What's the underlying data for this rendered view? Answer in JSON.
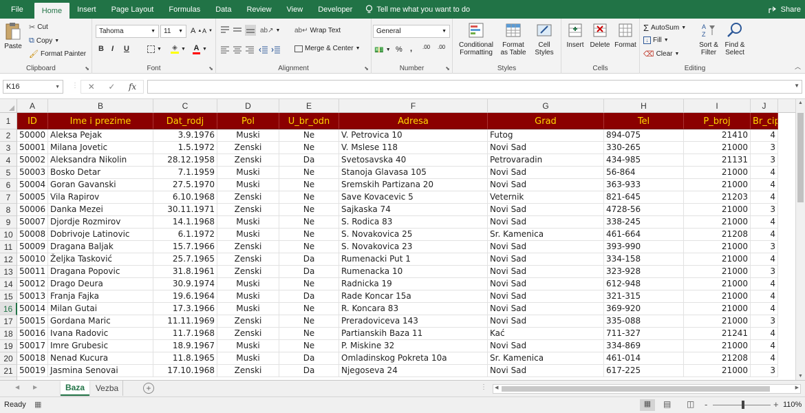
{
  "menu": {
    "tabs": [
      "File",
      "Home",
      "Insert",
      "Page Layout",
      "Formulas",
      "Data",
      "Review",
      "View",
      "Developer"
    ],
    "tell_me": "Tell me what you want to do",
    "share": "Share"
  },
  "ribbon": {
    "clipboard": {
      "label": "Clipboard",
      "paste": "Paste",
      "cut": "Cut",
      "copy": "Copy",
      "format_painter": "Format Painter"
    },
    "font": {
      "label": "Font",
      "name": "Tahoma",
      "size": "11",
      "bold": "B",
      "italic": "I",
      "underline": "U"
    },
    "alignment": {
      "label": "Alignment",
      "wrap_text": "Wrap Text",
      "merge_center": "Merge & Center"
    },
    "number": {
      "label": "Number",
      "format": "General",
      "percent": "%",
      "comma": ",",
      "inc_decimal": ".00",
      "dec_decimal": ".00"
    },
    "styles": {
      "label": "Styles",
      "conditional": "Conditional Formatting",
      "format_as_table": "Format as Table",
      "cell_styles": "Cell Styles"
    },
    "cells": {
      "label": "Cells",
      "insert": "Insert",
      "delete": "Delete",
      "format": "Format"
    },
    "editing": {
      "label": "Editing",
      "autosum": "AutoSum",
      "fill": "Fill",
      "clear": "Clear",
      "sort_filter": "Sort & Filter",
      "find_select": "Find & Select"
    }
  },
  "formula_bar": {
    "name_box": "K16",
    "fx": "fx",
    "content": ""
  },
  "columns": [
    "A",
    "B",
    "C",
    "D",
    "E",
    "F",
    "G",
    "H",
    "I",
    "J"
  ],
  "headers": [
    "ID",
    "Ime i prezime",
    "Dat_rodj",
    "Pol",
    "U_br_odn",
    "Adresa",
    "Grad",
    "Tel",
    "P_broj",
    "Br_cip"
  ],
  "rows": [
    [
      "50000",
      "Aleksa Pejak",
      "3.9.1976",
      "Muski",
      "Ne",
      "V. Petrovica 10",
      "Futog",
      "894-075",
      "21410",
      "4"
    ],
    [
      "50001",
      "Milana Jovetic",
      "1.5.1972",
      "Zenski",
      "Ne",
      "V. Mslese 118",
      "Novi Sad",
      "330-265",
      "21000",
      "3"
    ],
    [
      "50002",
      "Aleksandra Nikolin",
      "28.12.1958",
      "Zenski",
      "Da",
      "Svetosavska 40",
      "Petrovaradin",
      "434-985",
      "21131",
      "3"
    ],
    [
      "50003",
      "Bosko Detar",
      "7.1.1959",
      "Muski",
      "Ne",
      "Stanoja Glavasa 105",
      "Novi Sad",
      "56-864",
      "21000",
      "4"
    ],
    [
      "50004",
      "Goran Gavanski",
      "27.5.1970",
      "Muski",
      "Ne",
      "Sremskih Partizana 20",
      "Novi Sad",
      "363-933",
      "21000",
      "4"
    ],
    [
      "50005",
      "Vila Rapirov",
      "6.10.1968",
      "Zenski",
      "Ne",
      "Save Kovacevic 5",
      "Veternik",
      "821-645",
      "21203",
      "4"
    ],
    [
      "50006",
      "Danka Mezei",
      "30.11.1971",
      "Zenski",
      "Ne",
      "Sajkaska 74",
      "Novi Sad",
      "4728-56",
      "21000",
      "3"
    ],
    [
      "50007",
      "Djordje  Rozmirov",
      "14.1.1968",
      "Muski",
      "Ne",
      "S. Rodica 83",
      "Novi Sad",
      "338-245",
      "21000",
      "4"
    ],
    [
      "50008",
      "Dobrivoje Latinovic",
      "6.1.1972",
      "Muski",
      "Ne",
      "S. Novakovica 25",
      "Sr. Kamenica",
      "461-664",
      "21208",
      "4"
    ],
    [
      "50009",
      "Dragana Baljak",
      "15.7.1966",
      "Zenski",
      "Ne",
      "S. Novakovica 23",
      "Novi Sad",
      "393-990",
      "21000",
      "3"
    ],
    [
      "50010",
      "Željka Tasković",
      "25.7.1965",
      "Zenski",
      "Da",
      "Rumenacki Put 1",
      "Novi Sad",
      "334-158",
      "21000",
      "4"
    ],
    [
      "50011",
      "Dragana Popovic",
      "31.8.1961",
      "Zenski",
      "Da",
      "Rumenacka 10",
      "Novi Sad",
      "323-928",
      "21000",
      "3"
    ],
    [
      "50012",
      "Drago Deura",
      "30.9.1974",
      "Muski",
      "Ne",
      "Radnicka 19",
      "Novi Sad",
      "612-948",
      "21000",
      "4"
    ],
    [
      "50013",
      "Franja Fajka",
      "19.6.1964",
      "Muski",
      "Da",
      "Rade Koncar 15a",
      "Novi Sad",
      "321-315",
      "21000",
      "4"
    ],
    [
      "50014",
      "Milan Gutai",
      "17.3.1966",
      "Muski",
      "Ne",
      "R. Koncara 83",
      "Novi Sad",
      "369-920",
      "21000",
      "4"
    ],
    [
      "50015",
      "Gordana Maric",
      "11.11.1969",
      "Zenski",
      "Ne",
      "Preradoviceva 143",
      "Novi Sad",
      "335-088",
      "21000",
      "3"
    ],
    [
      "50016",
      "Ivana Radovic",
      "11.7.1968",
      "Zenski",
      "Ne",
      "Partianskih Baza 11",
      "Kać",
      "711-327",
      "21241",
      "4"
    ],
    [
      "50017",
      "Imre Grubesic",
      "18.9.1967",
      "Muski",
      "Ne",
      "P. Miskine 32",
      "Novi Sad",
      "334-869",
      "21000",
      "4"
    ],
    [
      "50018",
      "Nenad Kucura",
      "11.8.1965",
      "Muski",
      "Da",
      "Omladinskog Pokreta 10a",
      "Sr. Kamenica",
      "461-014",
      "21208",
      "4"
    ],
    [
      "50019",
      "Jasmina Senovai",
      "17.10.1968",
      "Zenski",
      "Da",
      "Njegoseva 24",
      "Novi Sad",
      "617-225",
      "21000",
      "3"
    ]
  ],
  "row_numbers": [
    "1",
    "2",
    "3",
    "4",
    "5",
    "6",
    "7",
    "8",
    "9",
    "10",
    "11",
    "12",
    "13",
    "14",
    "15",
    "16",
    "17",
    "18",
    "19",
    "20",
    "21"
  ],
  "sheets": {
    "tabs": [
      "Baza",
      "Vezba"
    ],
    "add": "+"
  },
  "status": {
    "ready": "Ready",
    "zoom": "110%",
    "zoom_minus": "-",
    "zoom_plus": "+"
  },
  "colors": {
    "accent": "#217346",
    "header_bg": "#8b0000",
    "header_text": "#ffd700"
  }
}
